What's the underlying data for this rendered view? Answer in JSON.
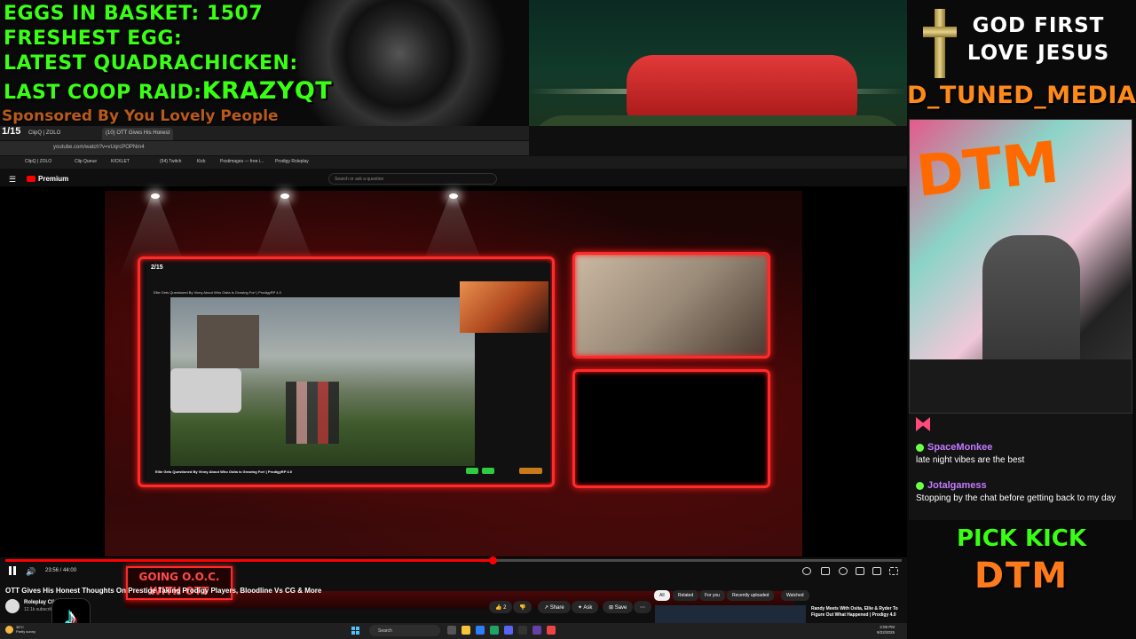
{
  "overlay": {
    "stats": [
      {
        "label": "EGGS IN BASKET:",
        "value": "1507"
      },
      {
        "label": "FRESHEST EGG:",
        "value": ""
      },
      {
        "label": "LATEST QUADRACHICKEN:",
        "value": ""
      },
      {
        "label": "LAST COOP RAID:",
        "value": "KRAZYQT"
      }
    ],
    "sponsor": "Sponsored By You Lovely People",
    "god_line1": "GOD FIRST",
    "god_line2": "LOVE JESUS",
    "brand_name": "D_TUNED_MEDIA",
    "pick_kick": "PICK KICK",
    "dtm": "DTM",
    "ooc_line1": "GOING O.O.C.",
    "ooc_line2": "WITH OTT",
    "poster_text": "DTM"
  },
  "chat": [
    {
      "user": "SpaceMonkee",
      "message": "late night vibes are the best"
    },
    {
      "user": "Jotalgamess",
      "message": "Stopping by the chat before getting back to my day"
    }
  ],
  "browser": {
    "tab_counter": "1/15",
    "tabs": [
      "ClipQ | ZOLO",
      "(10) OTT Gives His Honest"
    ],
    "url": "youtube.com/watch?v=vUqrcPOPNm4",
    "bookmarks": [
      "ClipQ | ZOLO",
      "Clip Queue",
      "KICKLET",
      "(54) Twitch",
      "Kick",
      "Postimages — free i...",
      "Prodigy Roleplay"
    ],
    "premium_label": "Premium",
    "search_placeholder": "Search or ask a question"
  },
  "inner_screen": {
    "counter": "2/15",
    "title": "Ellie Gets Questioned By Vinny About Who Osita is Growing For! | ProdigyRP 4.0"
  },
  "player": {
    "time": "23:56 / 44:00",
    "progress": 0.544,
    "title": "OTT Gives His Honest Thoughts On Prestige Taking Prodigy Players, Bloodline Vs CG & More",
    "channel": "Roleplay Clips",
    "subs": "12.1k subscribers",
    "likes": "2",
    "share": "Share",
    "ask": "Ask",
    "save": "Save",
    "chips": [
      "All",
      "Related",
      "For you",
      "Recently uploaded",
      "Watched"
    ],
    "rec_title": "Randy Meets With Osita, Ellie & Ryder To Figure Out What Happened | Prodigy 4.0"
  },
  "taskbar": {
    "weather_temp": "38°C",
    "weather_desc": "Partly sunny",
    "search_label": "Search",
    "time": "2:09 PM",
    "date": "9/22/2025"
  },
  "colors": {
    "neon_red": "#ff2a2a",
    "stat_green": "#39ff14",
    "brand_orange": "#ff8a1a"
  }
}
